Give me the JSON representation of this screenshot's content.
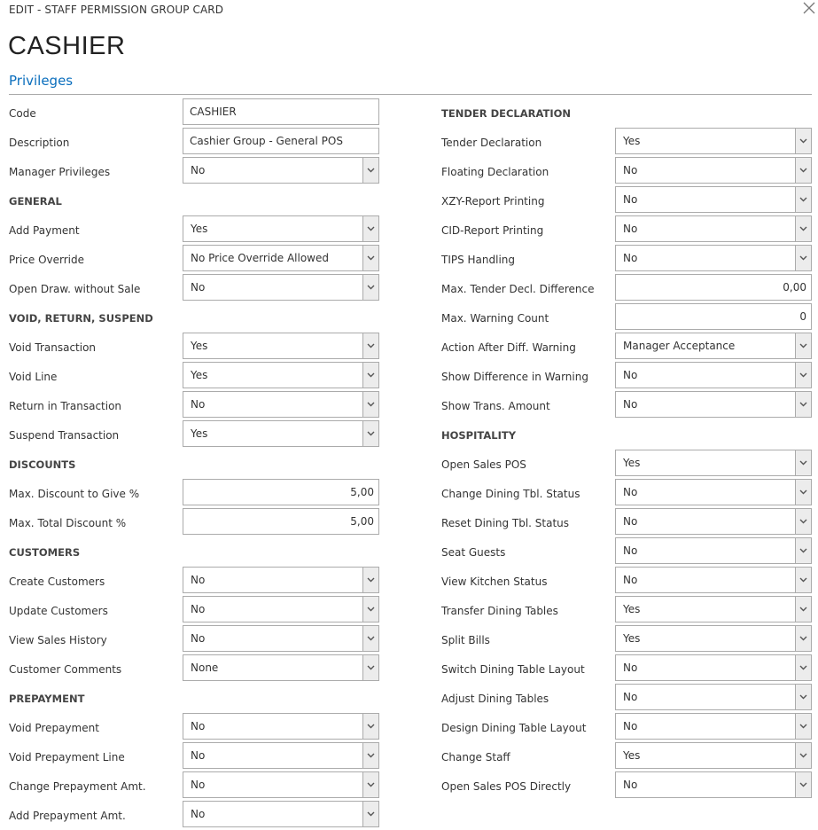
{
  "header": {
    "breadcrumb": "EDIT - STAFF PERMISSION GROUP CARD",
    "title": "CASHIER",
    "tab": "Privileges"
  },
  "left": [
    {
      "type": "text",
      "label": "Code",
      "value": "CASHIER"
    },
    {
      "type": "text",
      "label": "Description",
      "value": "Cashier Group - General POS"
    },
    {
      "type": "select",
      "label": "Manager Privileges",
      "value": "No"
    },
    {
      "type": "section",
      "label": "GENERAL"
    },
    {
      "type": "select",
      "label": "Add Payment",
      "value": "Yes"
    },
    {
      "type": "select",
      "label": "Price Override",
      "value": "No Price Override Allowed"
    },
    {
      "type": "select",
      "label": "Open Draw. without Sale",
      "value": "No"
    },
    {
      "type": "section",
      "label": "VOID, RETURN, SUSPEND"
    },
    {
      "type": "select",
      "label": "Void Transaction",
      "value": "Yes"
    },
    {
      "type": "select",
      "label": "Void Line",
      "value": "Yes"
    },
    {
      "type": "select",
      "label": "Return in Transaction",
      "value": "No"
    },
    {
      "type": "select",
      "label": "Suspend Transaction",
      "value": "Yes"
    },
    {
      "type": "section",
      "label": "DISCOUNTS"
    },
    {
      "type": "number",
      "label": "Max. Discount to Give %",
      "value": "5,00"
    },
    {
      "type": "number",
      "label": "Max. Total Discount %",
      "value": "5,00"
    },
    {
      "type": "section",
      "label": "CUSTOMERS"
    },
    {
      "type": "select",
      "label": "Create Customers",
      "value": "No"
    },
    {
      "type": "select",
      "label": "Update Customers",
      "value": "No"
    },
    {
      "type": "select",
      "label": "View Sales History",
      "value": "No"
    },
    {
      "type": "select",
      "label": "Customer Comments",
      "value": "None"
    },
    {
      "type": "section",
      "label": "PREPAYMENT"
    },
    {
      "type": "select",
      "label": "Void Prepayment",
      "value": "No"
    },
    {
      "type": "select",
      "label": "Void Prepayment Line",
      "value": "No"
    },
    {
      "type": "select",
      "label": "Change Prepayment Amt.",
      "value": "No"
    },
    {
      "type": "select",
      "label": "Add Prepayment Amt.",
      "value": "No"
    }
  ],
  "right": [
    {
      "type": "section",
      "label": "TENDER DECLARATION"
    },
    {
      "type": "select",
      "label": "Tender Declaration",
      "value": "Yes"
    },
    {
      "type": "select",
      "label": "Floating Declaration",
      "value": "No"
    },
    {
      "type": "select",
      "label": "XZY-Report Printing",
      "value": "No"
    },
    {
      "type": "select",
      "label": "CID-Report Printing",
      "value": "No"
    },
    {
      "type": "select",
      "label": "TIPS Handling",
      "value": "No"
    },
    {
      "type": "number",
      "label": "Max. Tender Decl. Difference",
      "value": "0,00"
    },
    {
      "type": "number",
      "label": "Max. Warning Count",
      "value": "0"
    },
    {
      "type": "select",
      "label": "Action After Diff. Warning",
      "value": "Manager Acceptance"
    },
    {
      "type": "select",
      "label": "Show Difference in Warning",
      "value": "No"
    },
    {
      "type": "select",
      "label": "Show Trans. Amount",
      "value": "No"
    },
    {
      "type": "section",
      "label": "HOSPITALITY"
    },
    {
      "type": "select",
      "label": "Open Sales POS",
      "value": "Yes"
    },
    {
      "type": "select",
      "label": "Change Dining Tbl. Status",
      "value": "No"
    },
    {
      "type": "select",
      "label": "Reset Dining Tbl. Status",
      "value": "No"
    },
    {
      "type": "select",
      "label": "Seat Guests",
      "value": "No"
    },
    {
      "type": "select",
      "label": "View Kitchen Status",
      "value": "No"
    },
    {
      "type": "select",
      "label": "Transfer Dining Tables",
      "value": "Yes"
    },
    {
      "type": "select",
      "label": "Split Bills",
      "value": "Yes"
    },
    {
      "type": "select",
      "label": "Switch Dining Table Layout",
      "value": "No"
    },
    {
      "type": "select",
      "label": "Adjust Dining Tables",
      "value": "No"
    },
    {
      "type": "select",
      "label": "Design Dining Table Layout",
      "value": "No"
    },
    {
      "type": "select",
      "label": "Change Staff",
      "value": "Yes"
    },
    {
      "type": "select",
      "label": "Open Sales POS Directly",
      "value": "No"
    }
  ]
}
